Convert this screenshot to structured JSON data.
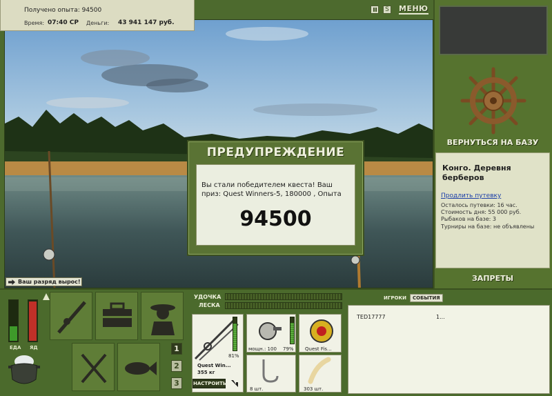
{
  "info": {
    "exp_text": "Получено опыта: 94500",
    "time_label": "Время:",
    "time_value": "07:40 СР",
    "money_label": "Деньги:",
    "money_value": "43 941 147 руб."
  },
  "topbar": {
    "menu_label": "МЕНЮ",
    "pause_icon": "pause-icon",
    "sound_icon": "sound-icon"
  },
  "right": {
    "return_label": "ВЕРНУТЬСЯ НА БАЗУ",
    "base_name": "Конго. Деревня берберов",
    "extend_link": "Продлить путевку",
    "remaining": "Осталось путевки: 16 час.",
    "day_cost": "Стоимость дня: 55 000 руб.",
    "fishers": "Рыбаков на базе: 3",
    "tournaments": "Турниры на базе: не объявлены",
    "bans_label": "ЗАПРЕТЫ"
  },
  "scene": {
    "rankup": "Ваш разряд вырос!"
  },
  "dialog": {
    "title": "ПРЕДУПРЕЖДЕНИЕ",
    "message": "Вы стали победителем квеста! Ваш приз: Quest Winners-5, 180000 , Опыта",
    "amount": "94500"
  },
  "status": {
    "food_label": "ЕДА",
    "food_level": 0.35,
    "alcohol_label": "ЯД",
    "alcohol_level": 0.95
  },
  "pages": [
    "1",
    "2",
    "3"
  ],
  "selected_page": "1",
  "tackle": {
    "rod_label": "УДОЧКА",
    "line_label": "ЛЕСКА",
    "rod_name": "Quest Win...",
    "rod_weight": "355 кг",
    "rod_pct": "81%",
    "reel_power": "мощн.: 100",
    "reel_pct": "79%",
    "line_name": "Quest Fis...",
    "hook_count": "8 шт.",
    "bait_count": "303 шт.",
    "setup_label": "НАСТРОИТЬ"
  },
  "players": {
    "tab_players": "ИГРОКИ",
    "tab_events": "СОБЫТИЯ",
    "rows": [
      {
        "name": "TED17777",
        "value": "1..."
      }
    ]
  },
  "colors": {
    "panel_green": "#4b6a2c",
    "dialog_green": "#5a7334",
    "light_panel": "#e0e2c8",
    "link_blue": "#1a3ea8",
    "food_fill": "#3e9a2a",
    "alcohol_fill": "#c03028"
  }
}
